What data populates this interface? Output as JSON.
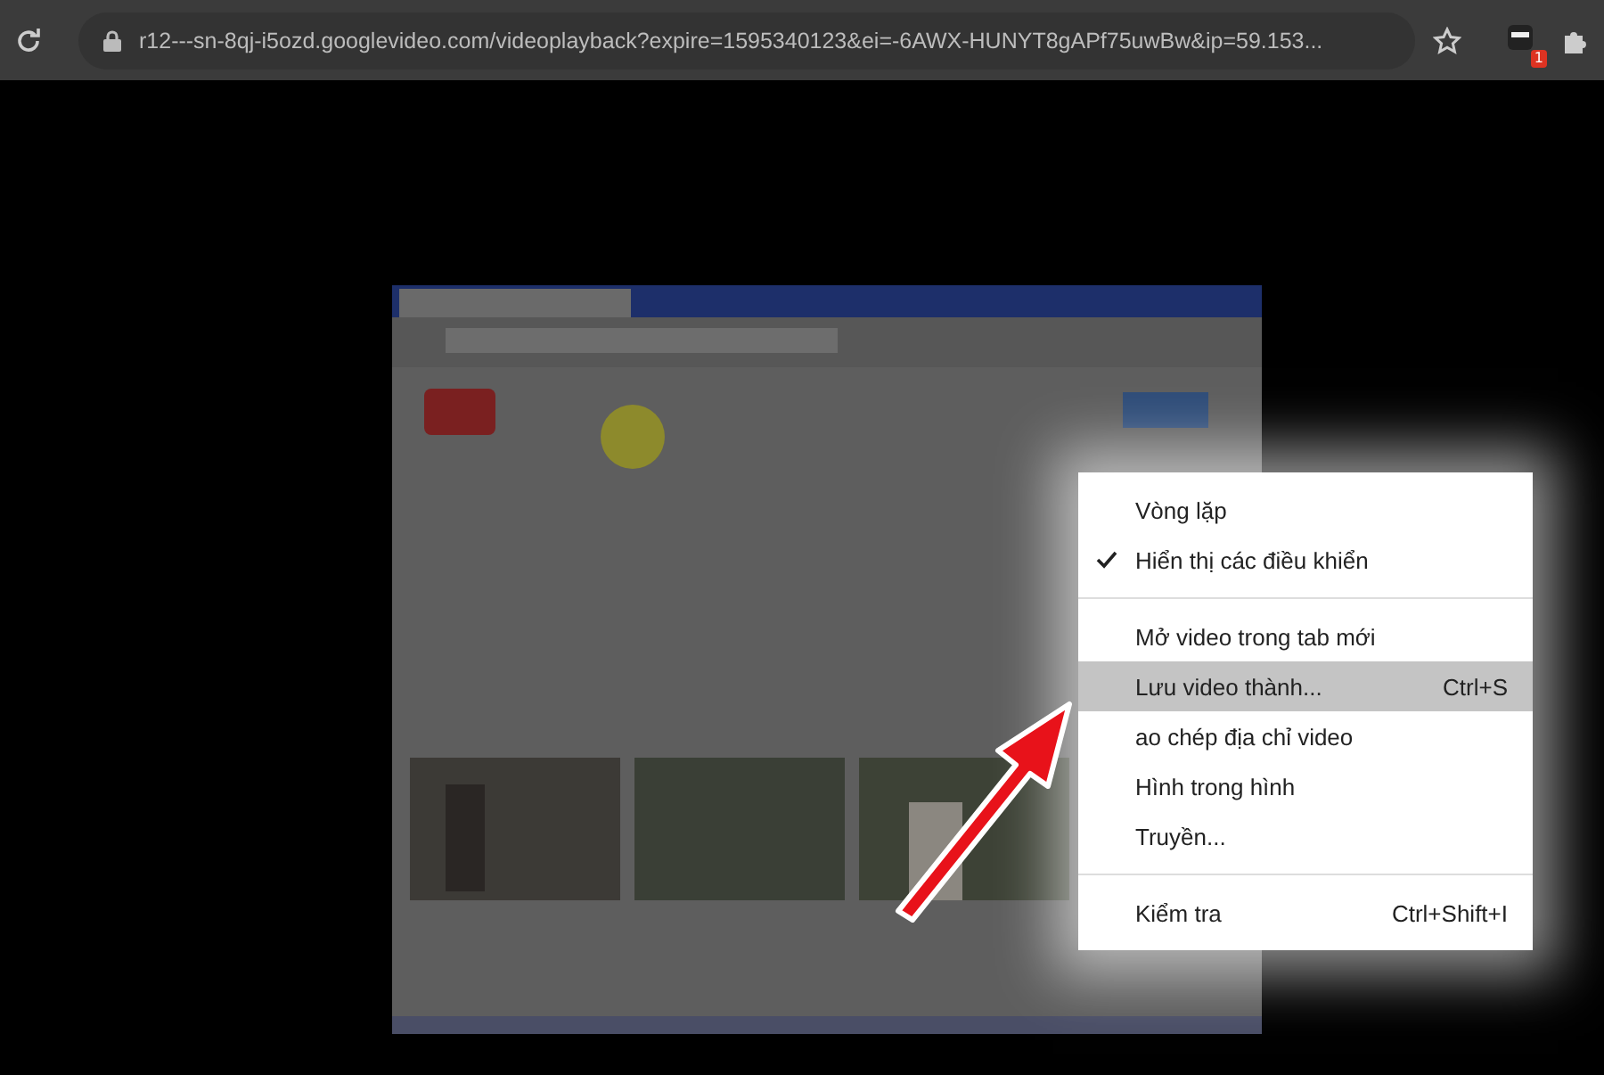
{
  "address_bar": {
    "url": "r12---sn-8qj-i5ozd.googlevideo.com/videoplayback?expire=1595340123&ei=-6AWX-HUNYT8gAPf75uwBw&ip=59.153...",
    "extension_badge": "1"
  },
  "context_menu": {
    "items": [
      {
        "kind": "item",
        "label": "Vòng lặp",
        "checked": false,
        "selected": false
      },
      {
        "kind": "item",
        "label": "Hiển thị các điều khiển",
        "checked": true,
        "selected": false
      },
      {
        "kind": "separator"
      },
      {
        "kind": "item",
        "label": "Mở video trong tab mới",
        "checked": false,
        "selected": false
      },
      {
        "kind": "item",
        "label": "Lưu video thành...",
        "shortcut": "Ctrl+S",
        "checked": false,
        "selected": true
      },
      {
        "kind": "item",
        "label": "ao chép địa chỉ video",
        "checked": false,
        "selected": false
      },
      {
        "kind": "item",
        "label": "Hình trong hình",
        "checked": false,
        "selected": false
      },
      {
        "kind": "item",
        "label": "Truyền...",
        "checked": false,
        "selected": false
      },
      {
        "kind": "separator"
      },
      {
        "kind": "item",
        "label": "Kiểm tra",
        "shortcut": "Ctrl+Shift+I",
        "checked": false,
        "selected": false
      }
    ]
  }
}
